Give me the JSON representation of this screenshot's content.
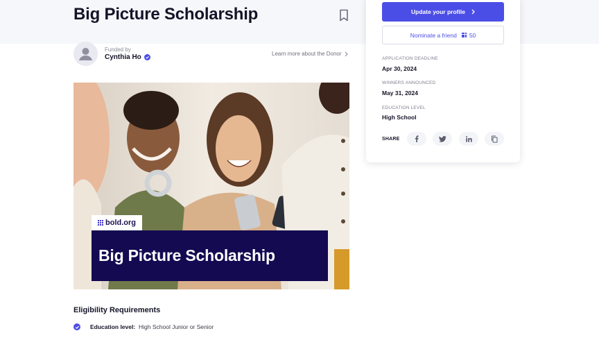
{
  "header": {
    "title": "Big Picture Scholarship"
  },
  "donor": {
    "funded_by_label": "Funded by",
    "name": "Cynthia Ho",
    "learn_more": "Learn more about the Donor"
  },
  "hero": {
    "brand": "bold.org",
    "banner_title": "Big Picture Scholarship"
  },
  "eligibility": {
    "section_title": "Eligibility Requirements",
    "items": [
      {
        "label": "Education level:",
        "value": "High School Junior or Senior"
      }
    ]
  },
  "sidebar": {
    "primary_button": "Update your profile",
    "nominate_button": "Nominate a friend",
    "nominate_points": "50",
    "application_deadline_label": "APPLICATION DEADLINE",
    "application_deadline": "Apr 30, 2024",
    "winners_announced_label": "WINNERS ANNOUNCED",
    "winners_announced": "May 31, 2024",
    "education_level_label": "EDUCATION LEVEL",
    "education_level": "High School",
    "share_label": "SHARE",
    "share_buttons": [
      "facebook-icon",
      "twitter-icon",
      "linkedin-icon",
      "copy-icon"
    ]
  },
  "colors": {
    "accent": "#4b4ee6",
    "banner": "#140a52",
    "top_band": "#f6f7fa"
  }
}
